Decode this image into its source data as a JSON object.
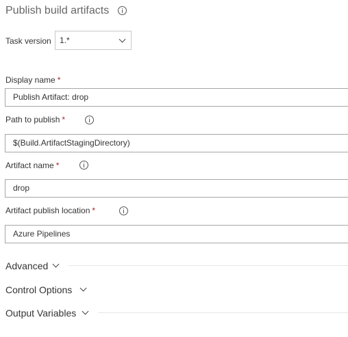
{
  "header": {
    "title": "Publish build artifacts",
    "info_icon": "info-icon"
  },
  "task_version": {
    "label": "Task version",
    "selected": "1.*"
  },
  "fields": {
    "display_name": {
      "label": "Display name",
      "required_mark": "*",
      "value": "Publish Artifact: drop"
    },
    "path_to_publish": {
      "label": "Path to publish",
      "required_mark": "*",
      "value": "$(Build.ArtifactStagingDirectory)"
    },
    "artifact_name": {
      "label": "Artifact name",
      "required_mark": "*",
      "value": "drop"
    },
    "publish_location": {
      "label": "Artifact publish location",
      "required_mark": "*",
      "value": "Azure Pipelines"
    }
  },
  "sections": {
    "advanced": "Advanced",
    "control_options": "Control Options",
    "output_variables": "Output Variables"
  },
  "colors": {
    "required": "#a4262c",
    "border": "#a6a6a6",
    "title": "#666666"
  }
}
